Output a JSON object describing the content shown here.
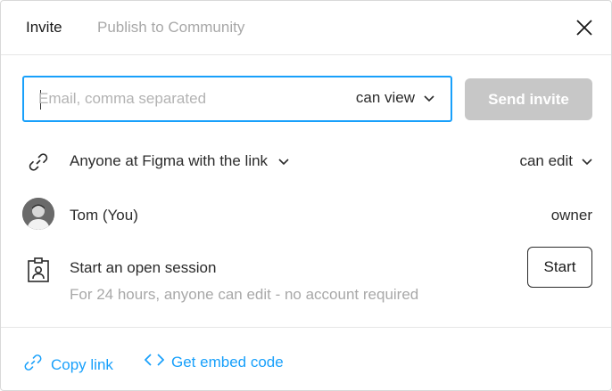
{
  "tabs": [
    {
      "label": "Invite",
      "active": true
    },
    {
      "label": "Publish to Community",
      "active": false
    }
  ],
  "invite": {
    "email_placeholder": "Email, comma separated",
    "permission": "can view",
    "send_label": "Send invite"
  },
  "link_access": {
    "label": "Anyone at Figma with the link",
    "permission": "can edit"
  },
  "member": {
    "name": "Tom (You)",
    "role": "owner"
  },
  "session": {
    "title": "Start an open session",
    "description": "For 24 hours, anyone can edit - no account required",
    "button_label": "Start"
  },
  "footer": {
    "copy_link": "Copy link",
    "embed_code": "Get embed code"
  },
  "colors": {
    "accent": "#18a0fb",
    "disabled_button": "#c7c7c7",
    "muted_text": "#a8a8a8"
  },
  "icons": [
    "close-icon",
    "chevron-down-icon",
    "link-icon",
    "avatar",
    "badge-icon",
    "code-icon"
  ]
}
